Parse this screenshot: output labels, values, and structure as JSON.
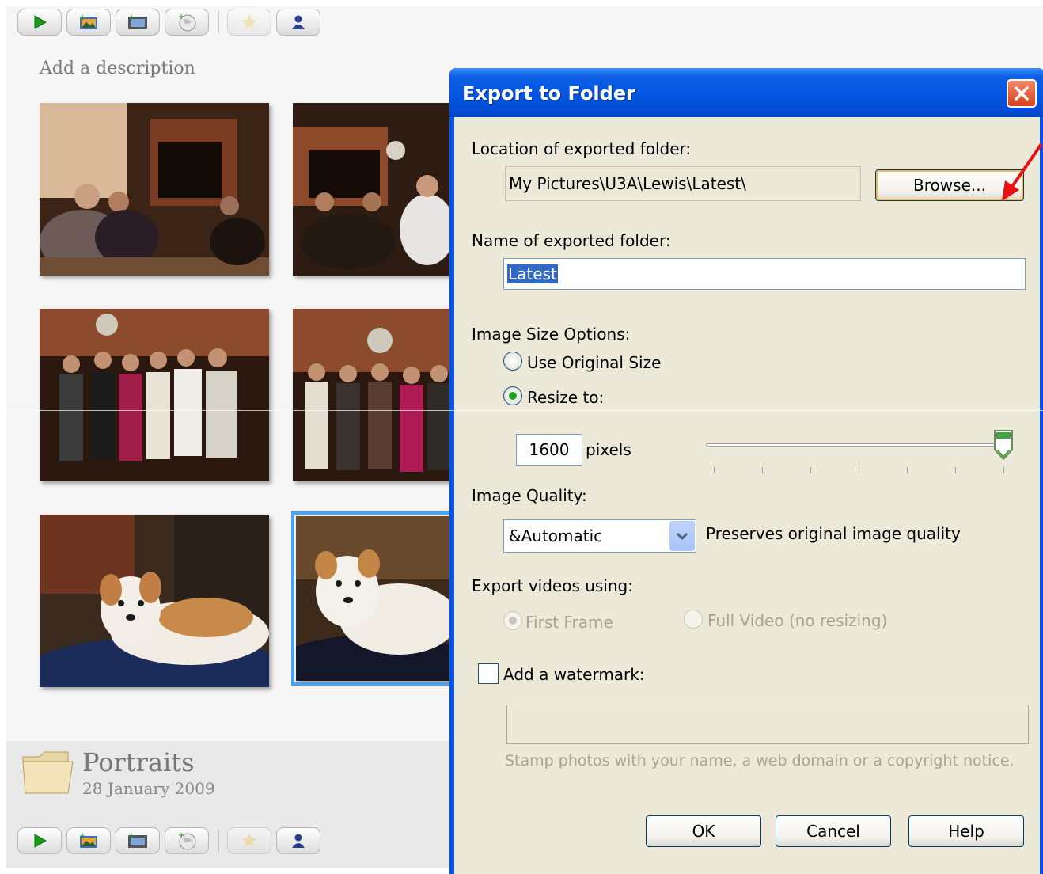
{
  "album": {
    "description_placeholder": "Add a description",
    "title": "Portraits",
    "date": "28 January 2009",
    "toolbar_icons": [
      "play-icon",
      "upload-icon",
      "movie-icon",
      "globe-icon",
      "star-icon",
      "person-icon"
    ]
  },
  "dialog": {
    "title": "Export to Folder",
    "location_label": "Location of exported folder:",
    "location_value": "My Pictures\\U3A\\Lewis\\Latest\\",
    "browse_label": "Browse...",
    "name_label": "Name of exported folder:",
    "name_value": "Latest",
    "size_label": "Image Size Options:",
    "use_original_label": "Use Original Size",
    "resize_label": "Resize to:",
    "resize_value": "1600",
    "pixels_label": "pixels",
    "size_slider_fraction": 1.0,
    "quality_label": "Image Quality:",
    "quality_selected": "&Automatic",
    "quality_note": "Preserves original image quality",
    "videos_label": "Export videos using:",
    "first_frame_label": "First Frame",
    "full_video_label": "Full Video (no resizing)",
    "watermark_label": "Add a watermark:",
    "watermark_hint": "Stamp photos with your name, a web domain or a copyright notice.",
    "ok_label": "OK",
    "cancel_label": "Cancel",
    "help_label": "Help",
    "selected_radio": "resize",
    "watermark_checked": false
  },
  "colors": {
    "titlebar": "#0454e0",
    "dialog_face": "#ece9d8",
    "selection_highlight": "#316ac5",
    "annotation_arrow": "#e81010"
  }
}
